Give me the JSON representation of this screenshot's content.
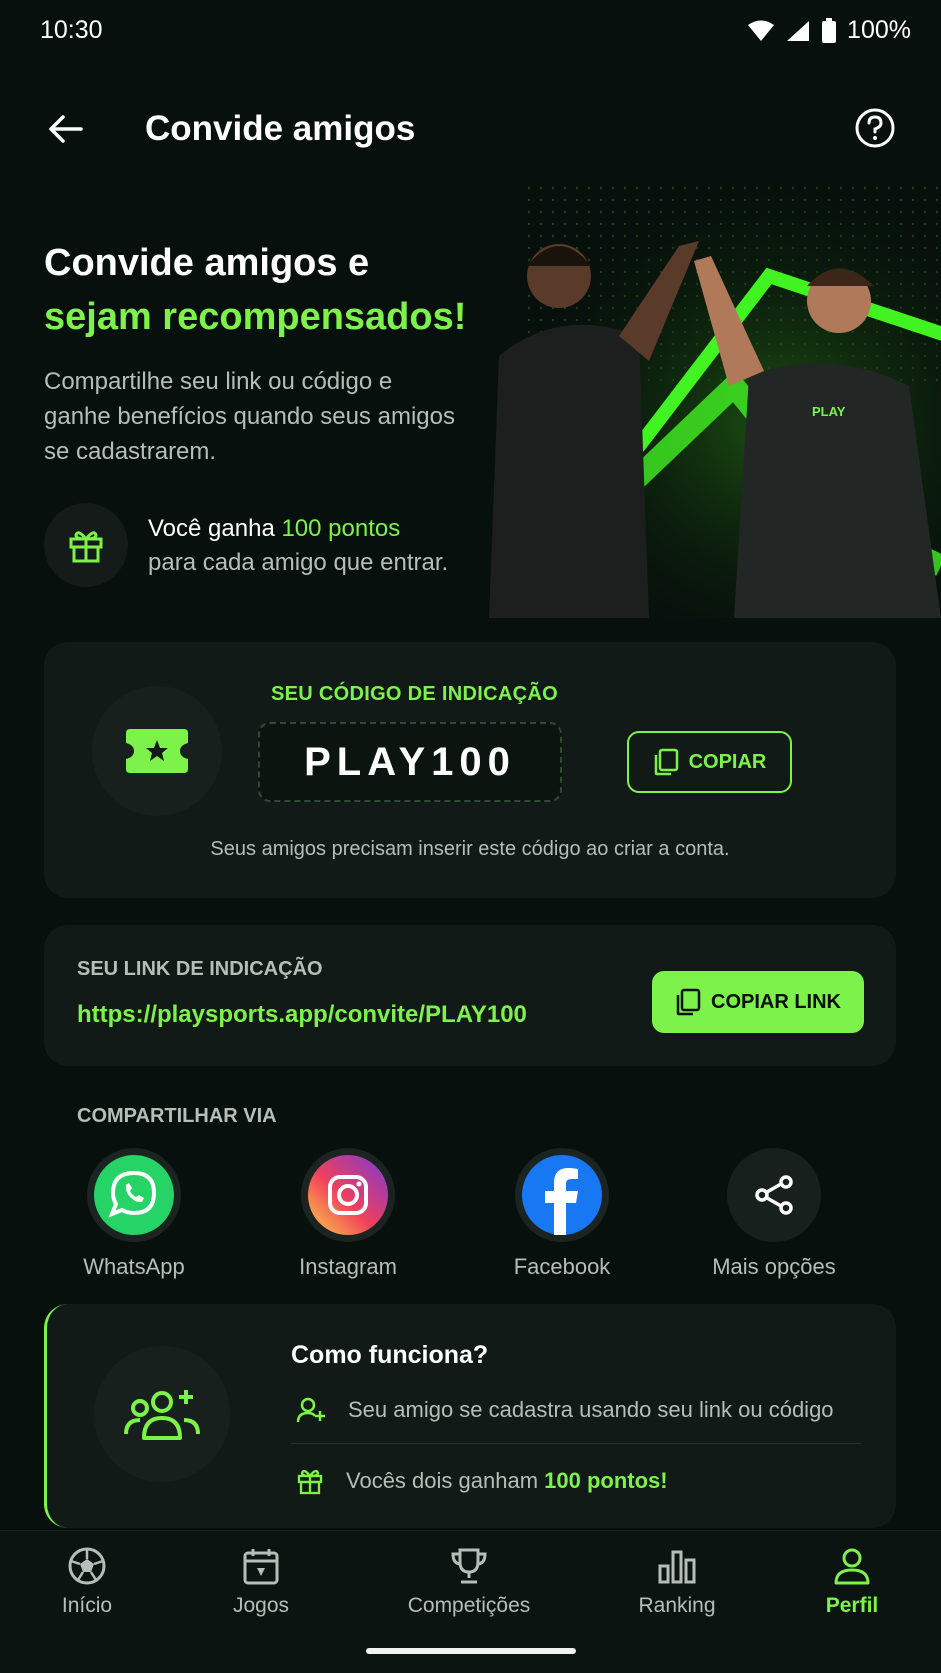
{
  "status_bar": {
    "time": "10:30",
    "battery": "100%"
  },
  "header": {
    "title": "Convide amigos"
  },
  "hero": {
    "title_line1": "Convide amigos e",
    "title_line2": "sejam recompensados!",
    "description": "Compartilhe seu link ou código e ganhe benefícios quando seus amigos se cadastrarem.",
    "reward_prefix": "Você ganha ",
    "reward_points": "100 pontos",
    "reward_suffix": "para cada amigo que entrar.",
    "shirt_logo_text": "PLAY"
  },
  "code_card": {
    "label": "SEU CÓDIGO DE INDICAÇÃO",
    "code": "PLAY100",
    "copy_label": "COPIAR",
    "hint": "Seus amigos precisam inserir este código ao criar a conta."
  },
  "link_card": {
    "label": "SEU LINK DE INDICAÇÃO",
    "url": "https://playsports.app/convite/PLAY100",
    "copy_label": "COPIAR LINK"
  },
  "share": {
    "label": "COMPARTILHAR VIA",
    "items": [
      {
        "name": "WhatsApp",
        "icon": "whatsapp-icon"
      },
      {
        "name": "Instagram",
        "icon": "instagram-icon"
      },
      {
        "name": "Facebook",
        "icon": "facebook-icon"
      },
      {
        "name": "Mais opções",
        "icon": "share-icon"
      }
    ]
  },
  "how_it_works": {
    "title": "Como funciona?",
    "step1": "Seu amigo se cadastra usando seu link ou código",
    "step2_prefix": "Vocês dois ganham ",
    "step2_points": "100 pontos!"
  },
  "bottom_nav": {
    "items": [
      {
        "label": "Início",
        "icon": "soccer-ball-icon"
      },
      {
        "label": "Jogos",
        "icon": "calendar-icon"
      },
      {
        "label": "Competições",
        "icon": "trophy-icon"
      },
      {
        "label": "Ranking",
        "icon": "bar-chart-icon"
      },
      {
        "label": "Perfil",
        "icon": "user-icon",
        "active": true
      }
    ]
  },
  "colors": {
    "accent": "#7cf24a",
    "background": "#07100c",
    "card": "#111a16"
  }
}
